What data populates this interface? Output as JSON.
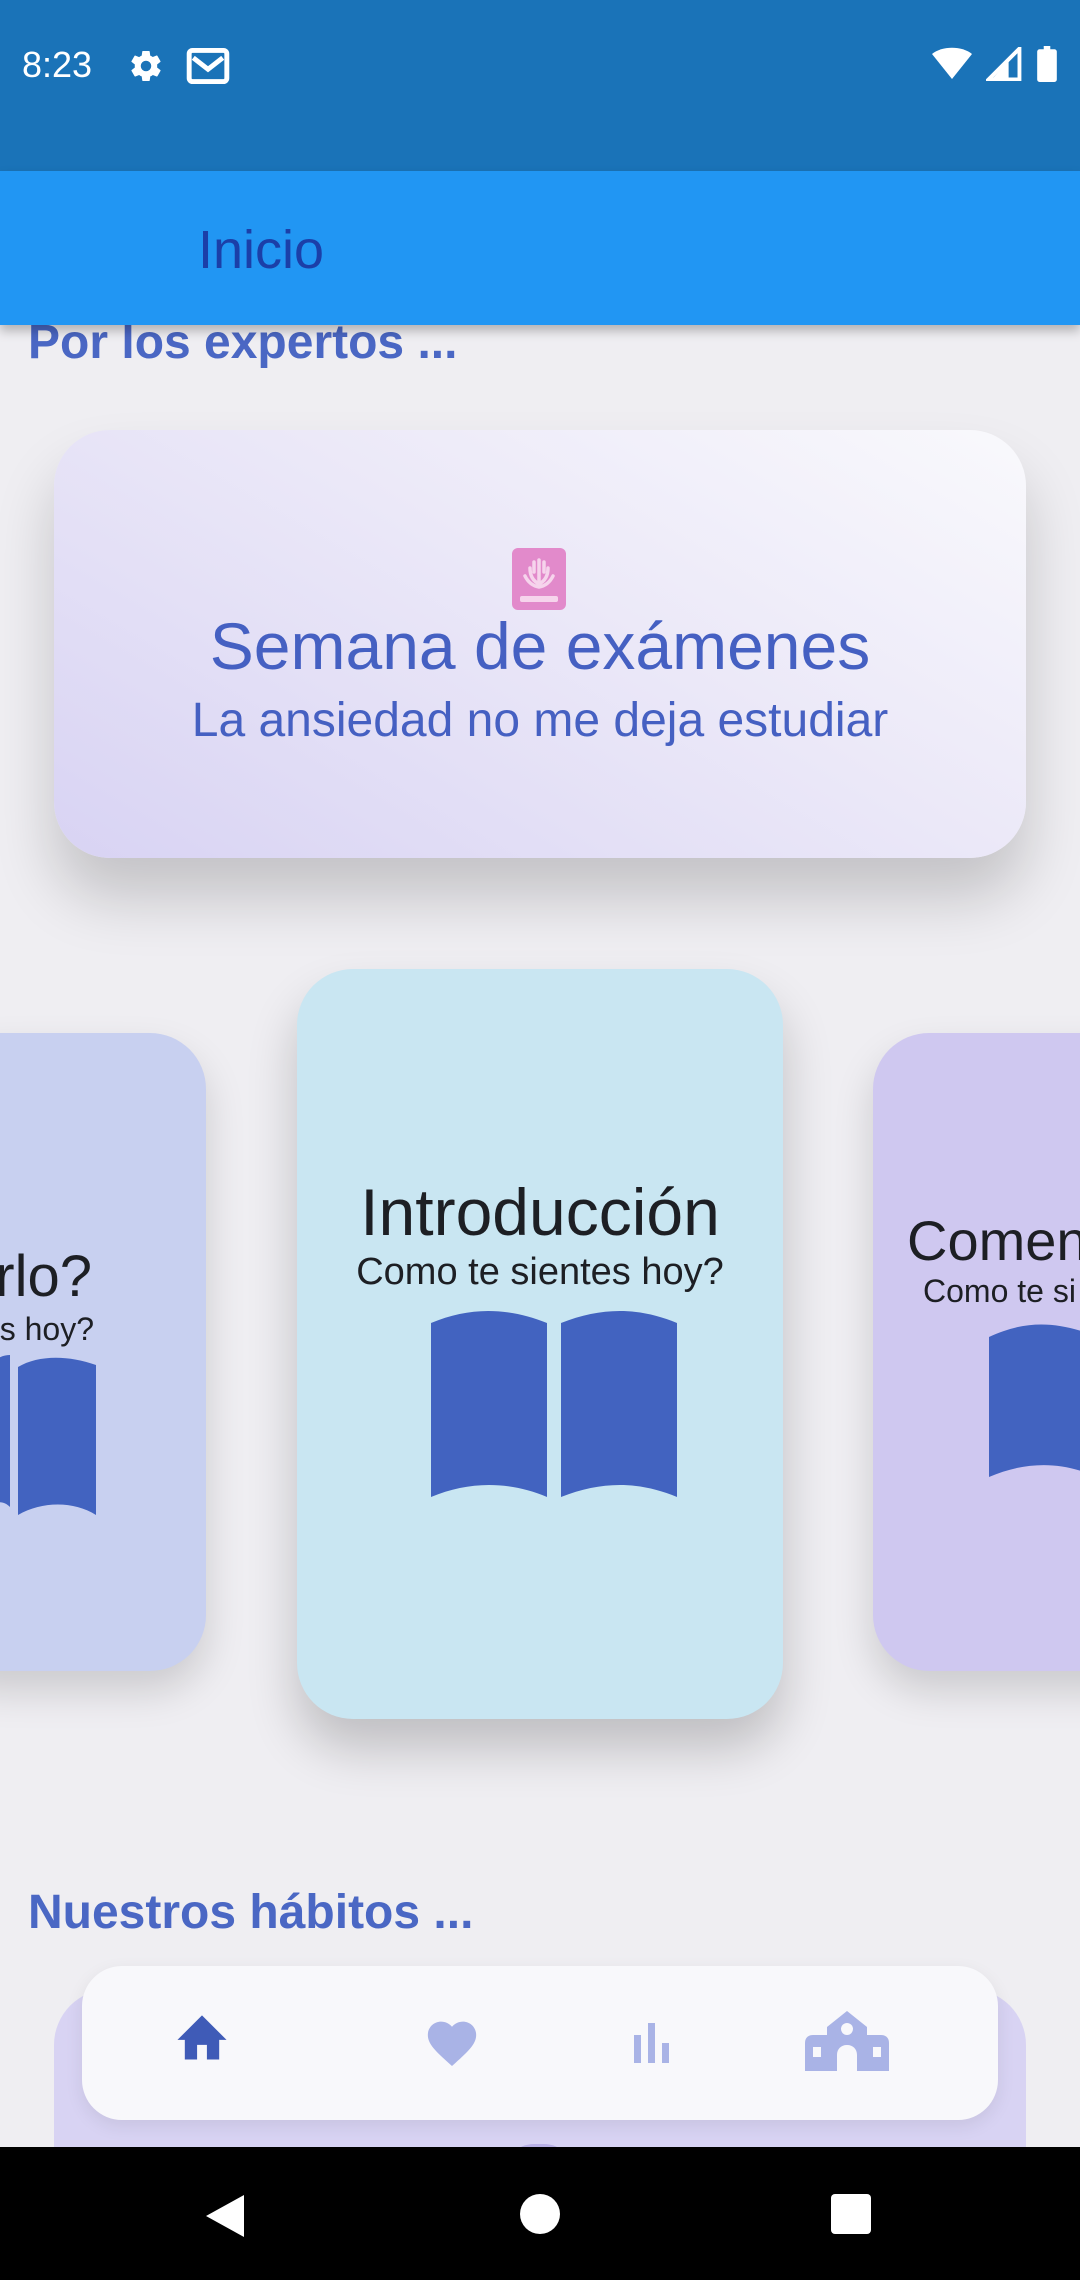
{
  "status_bar": {
    "time": "8:23",
    "icons_left": [
      "gear-icon",
      "mail-icon"
    ],
    "icons_right": [
      "wifi-icon",
      "signal-icon",
      "battery-icon"
    ]
  },
  "app_bar": {
    "title": "Inicio"
  },
  "sections": {
    "experts_title": "Por los expertos ...",
    "habits_title": "Nuestros hábitos ..."
  },
  "featured_card": {
    "icon": "book-icon",
    "title": "Semana de exámenes",
    "subtitle": "La ansiedad no me deja estudiar"
  },
  "carousel": {
    "left": {
      "title": "rlo?",
      "subtitle": "entes hoy?",
      "icon": "open-book-icon"
    },
    "center": {
      "title": "Introducción",
      "subtitle": "Como te sientes hoy?",
      "icon": "open-book-icon"
    },
    "right": {
      "title": "Comen",
      "subtitle": "Como te si",
      "icon": "open-book-icon"
    }
  },
  "bottom_nav": {
    "items": [
      {
        "icon": "home-icon",
        "active": true
      },
      {
        "icon": "heart-icon",
        "active": false
      },
      {
        "icon": "bar-chart-icon",
        "active": false
      },
      {
        "icon": "school-icon",
        "active": false
      }
    ]
  },
  "colors": {
    "status_bar": "#1a73b8",
    "app_bar": "#2196f3",
    "accent": "#4560c2",
    "nav_active": "#3f5bb7",
    "nav_inactive": "#a9b3e6"
  }
}
